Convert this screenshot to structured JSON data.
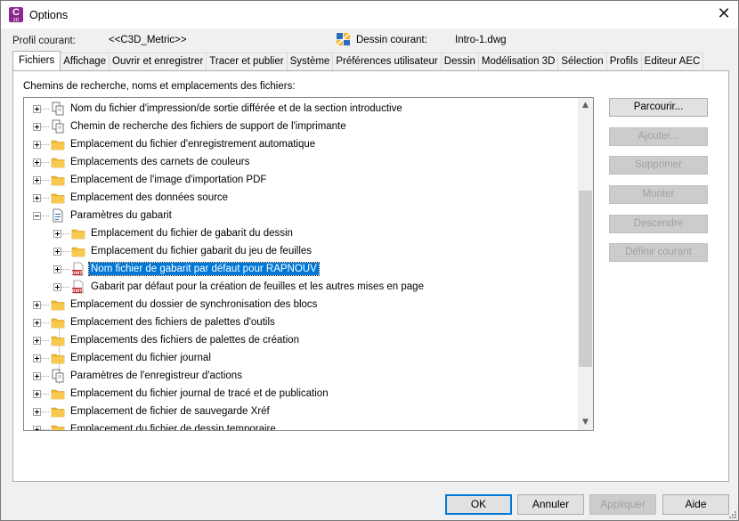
{
  "window": {
    "title": "Options",
    "app_icon_letter": "C",
    "app_icon_sub": "3D",
    "close_glyph": "✕"
  },
  "header": {
    "profile_label": "Profil courant:",
    "profile_value": "<<C3D_Metric>>",
    "drawing_label": "Dessin courant:",
    "drawing_value": "Intro-1.dwg"
  },
  "tabs": [
    {
      "label": "Fichiers",
      "active": true
    },
    {
      "label": "Affichage"
    },
    {
      "label": "Ouvrir et enregistrer"
    },
    {
      "label": "Tracer et publier"
    },
    {
      "label": "Système"
    },
    {
      "label": "Préférences utilisateur"
    },
    {
      "label": "Dessin"
    },
    {
      "label": "Modélisation 3D"
    },
    {
      "label": "Sélection"
    },
    {
      "label": "Profils"
    },
    {
      "label": "Editeur AEC"
    }
  ],
  "files_tab": {
    "section_label": "Chemins de recherche, noms et emplacements des fichiers:",
    "tree_items": [
      {
        "label": "Nom du fichier d'impression/de sortie différée et de la section introductive",
        "icon": "documents-icon",
        "level": 0,
        "expanded": false
      },
      {
        "label": "Chemin de recherche des fichiers de support de l'imprimante",
        "icon": "documents-icon",
        "level": 0,
        "expanded": false
      },
      {
        "label": "Emplacement du fichier d'enregistrement automatique",
        "icon": "folder-icon",
        "level": 0,
        "expanded": false
      },
      {
        "label": "Emplacements des carnets de couleurs",
        "icon": "folder-icon",
        "level": 0,
        "expanded": false
      },
      {
        "label": "Emplacement de l'image d'importation PDF",
        "icon": "folder-icon",
        "level": 0,
        "expanded": false
      },
      {
        "label": "Emplacement des données source",
        "icon": "folder-icon",
        "level": 0,
        "expanded": false
      },
      {
        "label": "Paramètres du gabarit",
        "icon": "template-settings-icon",
        "level": 0,
        "expanded": true
      },
      {
        "label": "Emplacement du fichier de gabarit du dessin",
        "icon": "folder-icon",
        "level": 1,
        "expanded": false
      },
      {
        "label": "Emplacement du fichier gabarit du jeu de feuilles",
        "icon": "folder-icon",
        "level": 1,
        "expanded": false
      },
      {
        "label": "Nom fichier de gabarit par défaut pour RAPNOUV",
        "icon": "dwt-file-icon",
        "level": 1,
        "expanded": false,
        "selected": true
      },
      {
        "label": "Gabarit par défaut pour la création de feuilles et les autres mises en page",
        "icon": "dwt-file-icon",
        "level": 1,
        "expanded": false
      },
      {
        "label": "Emplacement du dossier de synchronisation des blocs",
        "icon": "folder-icon",
        "level": 0,
        "expanded": false
      },
      {
        "label": "Emplacement des fichiers de palettes d'outils",
        "icon": "folder-icon",
        "level": 0,
        "expanded": false
      },
      {
        "label": "Emplacements des fichiers de palettes de création",
        "icon": "folder-icon",
        "level": 0,
        "expanded": false
      },
      {
        "label": "Emplacement du fichier journal",
        "icon": "folder-icon",
        "level": 0,
        "expanded": false
      },
      {
        "label": "Paramètres de l'enregistreur d'actions",
        "icon": "documents-icon",
        "level": 0,
        "expanded": false
      },
      {
        "label": "Emplacement du fichier journal de tracé et de publication",
        "icon": "folder-icon",
        "level": 0,
        "expanded": false
      },
      {
        "label": "Emplacement de fichier de sauvegarde Xréf",
        "icon": "folder-icon",
        "level": 0,
        "expanded": false
      },
      {
        "label": "Emplacement du fichier de dessin temporaire",
        "icon": "folder-icon",
        "level": 0,
        "expanded": false
      }
    ],
    "buttons": {
      "browse": "Parcourir...",
      "add": "Ajouter...",
      "remove": "Supprimer",
      "move_up": "Monter",
      "move_down": "Descendre",
      "set_current": "Définir courant"
    }
  },
  "footer": {
    "ok": "OK",
    "cancel": "Annuler",
    "apply": "Appliquer",
    "help": "Aide"
  },
  "colors": {
    "selection": "#0078d7",
    "folder": "#f2b632",
    "dwt_badge": "#c62828"
  }
}
